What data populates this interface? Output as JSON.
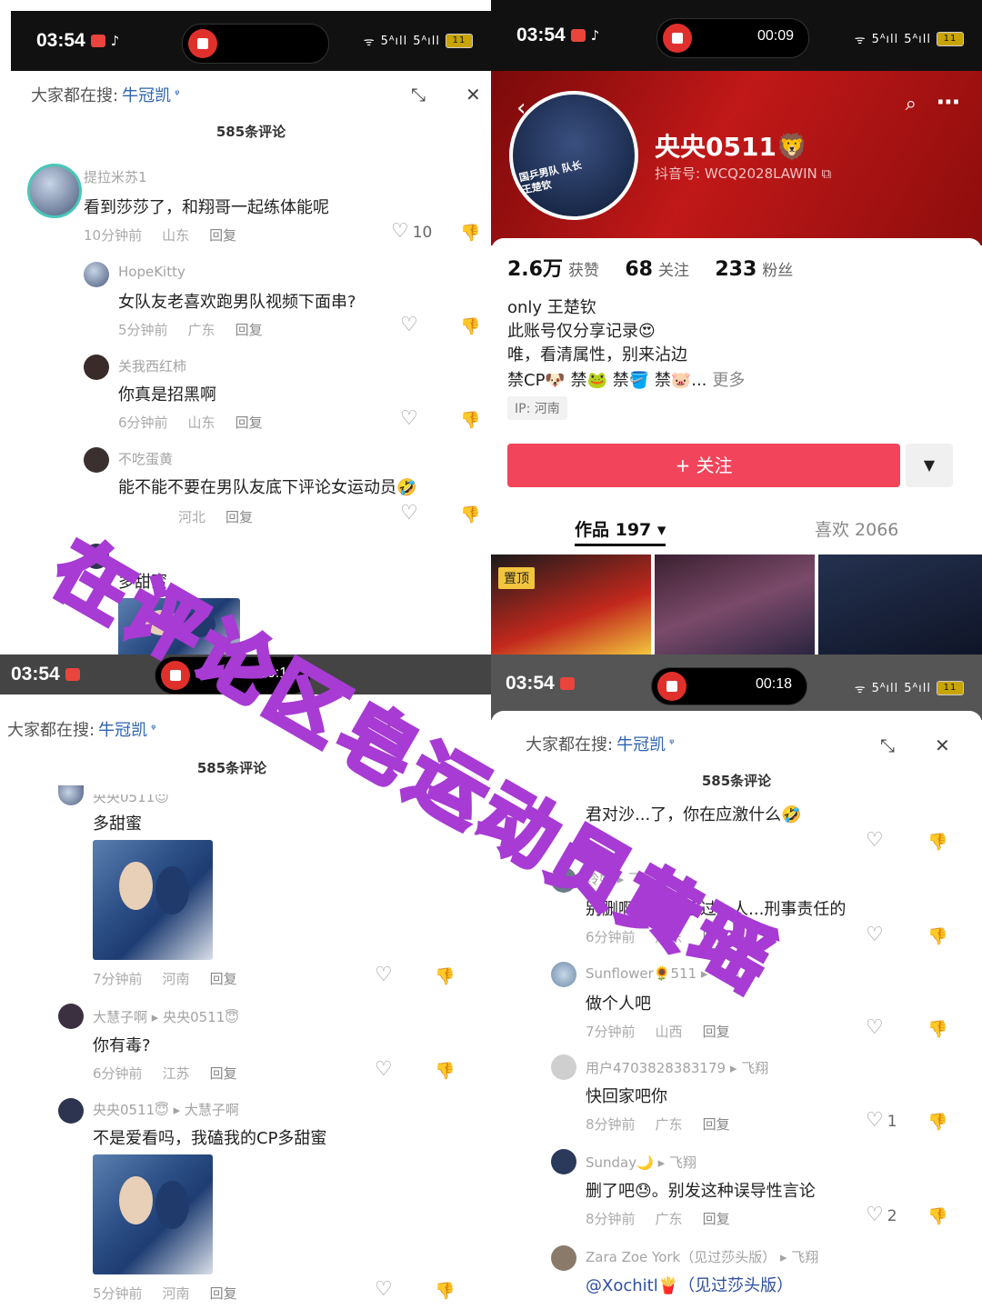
{
  "colors": {
    "accent_red": "#f2445a",
    "profile_bg": "#c11818",
    "keyword_blue": "#2d64b0",
    "overlay_purple": "#a73bd3"
  },
  "overlay_text": "在评论区皂运动员黄瑶",
  "panel_tl": {
    "status": {
      "time": "03:54",
      "tiktok_icon": "♪"
    },
    "search": {
      "prefix": "大家都在搜:",
      "keyword": "牛冠凯",
      "search_mark": "ᵠ"
    },
    "count": "585条评论",
    "comments": [
      {
        "user": "提拉米苏1",
        "text": "看到莎莎了，和翔哥一起练体能呢",
        "time": "10分钟前",
        "loc": "山东",
        "reply": "回复",
        "likes": "10"
      },
      {
        "user": "HopeKitty",
        "text": "女队友老喜欢跑男队视频下面串?",
        "time": "5分钟前",
        "loc": "广东",
        "reply": "回复",
        "likes": ""
      },
      {
        "user": "关我西红柿",
        "text": "你真是招黑啊",
        "time": "6分钟前",
        "loc": "山东",
        "reply": "回复",
        "likes": ""
      },
      {
        "user": "不吃蛋黄",
        "text": "能不能不要在男队友底下评论女运动员🤣",
        "time": "",
        "loc": "河北",
        "reply": "回复",
        "likes": ""
      },
      {
        "user": "",
        "text": "多甜蜜",
        "time": "",
        "loc": "",
        "reply": "",
        "likes": ""
      }
    ]
  },
  "panel_tr": {
    "status": {
      "time": "03:54",
      "timer": "00:09"
    },
    "profile": {
      "name": "央央0511🦁",
      "douyin_id": "抖音号: WCQ2028LAWIN ⧉",
      "stats": [
        {
          "num": "2.6万",
          "label": "获赞"
        },
        {
          "num": "68",
          "label": "关注"
        },
        {
          "num": "233",
          "label": "粉丝"
        }
      ],
      "bio": [
        "only 王楚钦",
        "此账号仅分享记录😍",
        "唯，看清属性，别来沾边",
        "禁CP🐶 禁🐸 禁🪣 禁🐷..."
      ],
      "bio_more": "更多",
      "ip": "IP: 河南",
      "follow": "+ 关注",
      "dropdown": "▼",
      "tab_works": "作品 197 ▾",
      "tab_likes": "喜欢 2066",
      "pinned": "置顶",
      "avatar_text": "国乒男队 队长王楚钦"
    }
  },
  "panel_bl": {
    "status": {
      "time": "03:54",
      "timer": "00:13"
    },
    "search": {
      "prefix": "大家都在搜:",
      "keyword": "牛冠凯",
      "search_mark": "ᵠ"
    },
    "count": "585条评论",
    "comments": [
      {
        "user": "央央0511😇",
        "text": "多甜蜜",
        "time": "7分钟前",
        "loc": "河南",
        "reply": "回复",
        "likes": ""
      },
      {
        "user": "大慧子啊 ▸ 央央0511😇",
        "text": "你有毒?",
        "time": "6分钟前",
        "loc": "江苏",
        "reply": "回复",
        "likes": ""
      },
      {
        "user": "央央0511😇 ▸ 大慧子啊",
        "text": "不是爱看吗，我磕我的CP多甜蜜",
        "time": "5分钟前",
        "loc": "河南",
        "reply": "回复",
        "likes": ""
      }
    ]
  },
  "panel_br": {
    "status": {
      "time": "03:54",
      "timer": "00:18"
    },
    "search": {
      "prefix": "大家都在搜:",
      "keyword": "牛冠凯",
      "search_mark": "ᵠ"
    },
    "count": "585条评论",
    "comments": [
      {
        "user": "",
        "text": "君对沙...了，你在应激什么🤣",
        "time": "",
        "loc": "",
        "reply": "",
        "likes": ""
      },
      {
        "user": "玲姐 ▸ 飞翔",
        "text": "别删啊，已经超过...人...刑事责任的",
        "time": "6分钟前",
        "loc": "广东",
        "reply": "回复",
        "likes": ""
      },
      {
        "user": "Sunflower🌻511 ▸ 飞翔",
        "text": "做个人吧",
        "time": "7分钟前",
        "loc": "山西",
        "reply": "回复",
        "likes": ""
      },
      {
        "user": "用户4703828383179 ▸ 飞翔",
        "text": "快回家吧你",
        "time": "8分钟前",
        "loc": "广东",
        "reply": "回复",
        "likes": "1"
      },
      {
        "user": "Sunday🌙 ▸ 飞翔",
        "text": "删了吧😓。别发这种误导性言论",
        "time": "8分钟前",
        "loc": "广东",
        "reply": "回复",
        "likes": "2"
      },
      {
        "user": "Zara Zoe York（见过莎头版） ▸ 飞翔",
        "text": "@Xochitl🍟（见过莎头版）",
        "time": "",
        "loc": "",
        "reply": "",
        "likes": ""
      }
    ]
  },
  "icons": {
    "heart": "♡",
    "dislike": "👎",
    "close": "✕",
    "expand": "⤡",
    "back": "‹",
    "search": "⌕",
    "more": "⋯"
  }
}
